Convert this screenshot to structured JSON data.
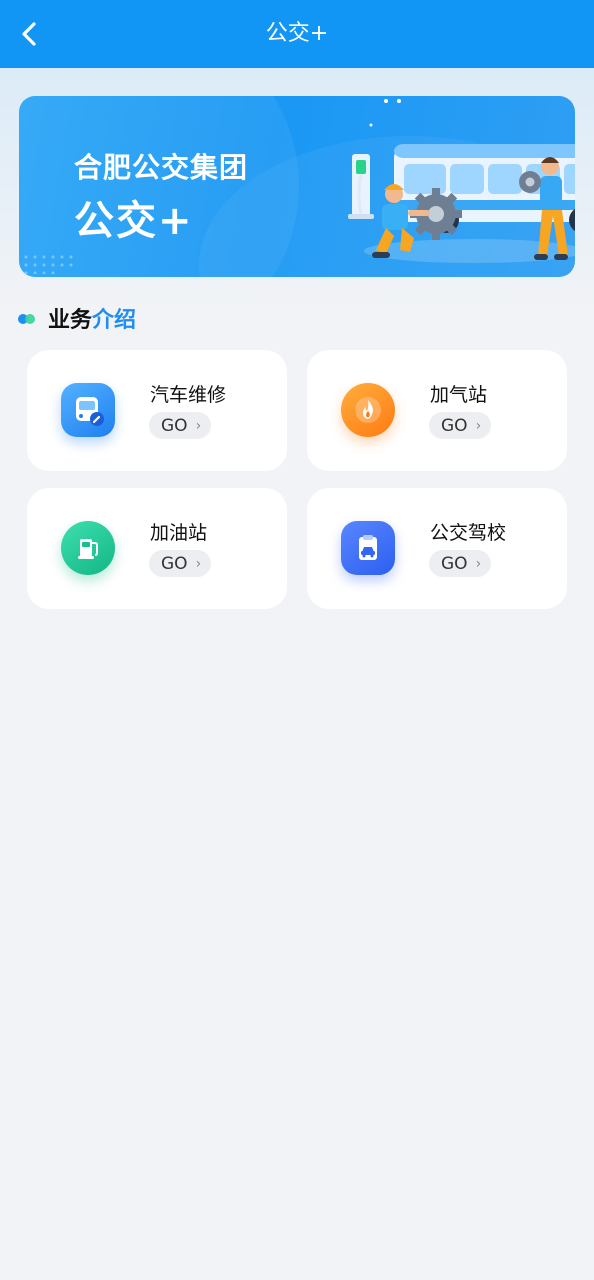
{
  "header": {
    "title": "公交+",
    "back_icon": "chevron-left-icon"
  },
  "banner": {
    "line1": "合肥公交集团",
    "line2": "公交+"
  },
  "section": {
    "title_part1": "业务",
    "title_part2": "介绍"
  },
  "services": [
    {
      "label": "汽车维修",
      "go_label": "GO",
      "icon": "bus-repair-icon",
      "color": "#2b8ef5"
    },
    {
      "label": "加气站",
      "go_label": "GO",
      "icon": "flame-icon",
      "color": "#ff8a1c"
    },
    {
      "label": "加油站",
      "go_label": "GO",
      "icon": "fuel-pump-icon",
      "color": "#18c08e"
    },
    {
      "label": "公交驾校",
      "go_label": "GO",
      "icon": "driving-school-car-icon",
      "color": "#3466f2"
    }
  ],
  "colors": {
    "header": "#1296f5",
    "accent": "#1e8ef2",
    "background": "#f1f3f6"
  }
}
